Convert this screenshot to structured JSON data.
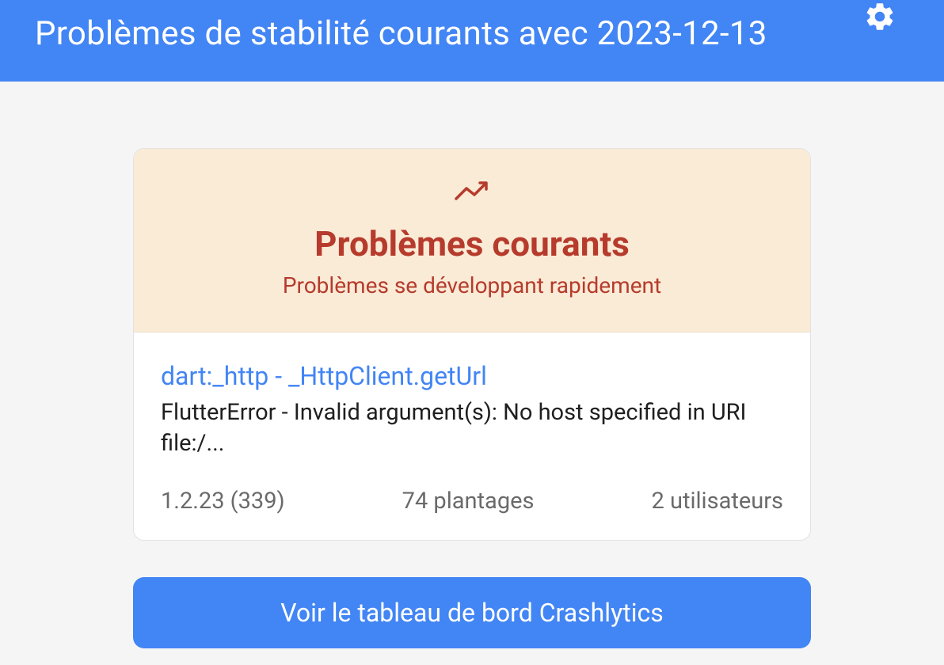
{
  "header": {
    "title": "Problèmes de stabilité courants avec 2023-12-13"
  },
  "card": {
    "title": "Problèmes courants",
    "subtitle": "Problèmes se développant rapidement"
  },
  "issue": {
    "link_label": "dart:_http - _HttpClient.getUrl",
    "description": "FlutterError - Invalid argument(s): No host specified in URI file:/...",
    "version": "1.2.23 (339)",
    "crashes": "74 plantages",
    "users": "2 utilisateurs"
  },
  "actions": {
    "view_dashboard": "Voir le tableau de bord Crashlytics"
  }
}
